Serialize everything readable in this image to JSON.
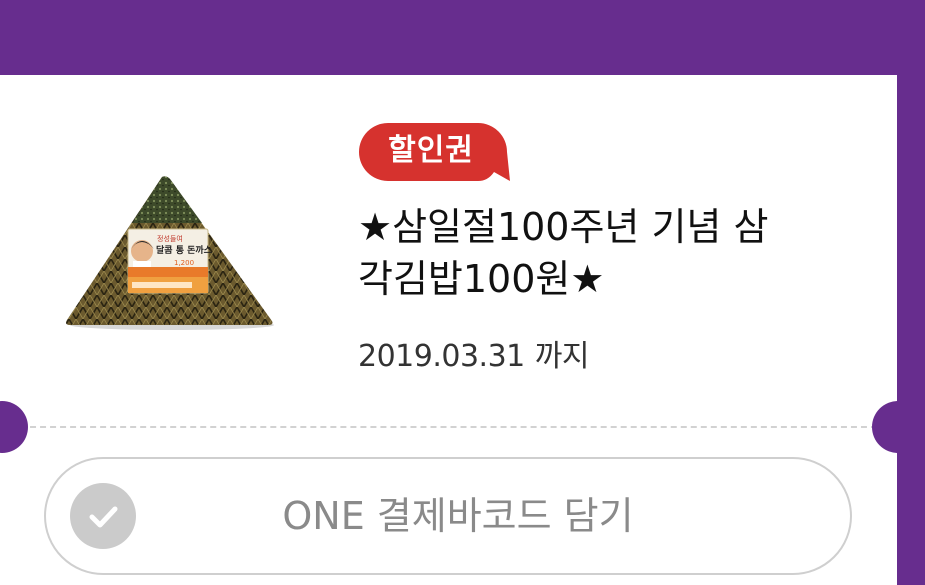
{
  "coupon": {
    "badge": "할인권",
    "title": "★삼일절100주년 기념 삼각김밥100원★",
    "title_lines": [
      "★삼일절100주년 기념 삼",
      "각김밥100원★"
    ],
    "expiry_date": "2019.03.31",
    "expiry_suffix": "까지",
    "product_image": {
      "label_top": "정성들여",
      "label_name": "달콤 통 돈까스",
      "price": "1,200",
      "icon": "onigiri-product-image"
    },
    "barcode_button_label": "ONE 결제바코드 담기",
    "check_icon": "check-circle-icon"
  },
  "colors": {
    "background": "#672d8e",
    "badge": "#d6322e",
    "card": "#ffffff",
    "check_inactive": "#cbcbcb",
    "button_text": "#8a8a8a"
  }
}
